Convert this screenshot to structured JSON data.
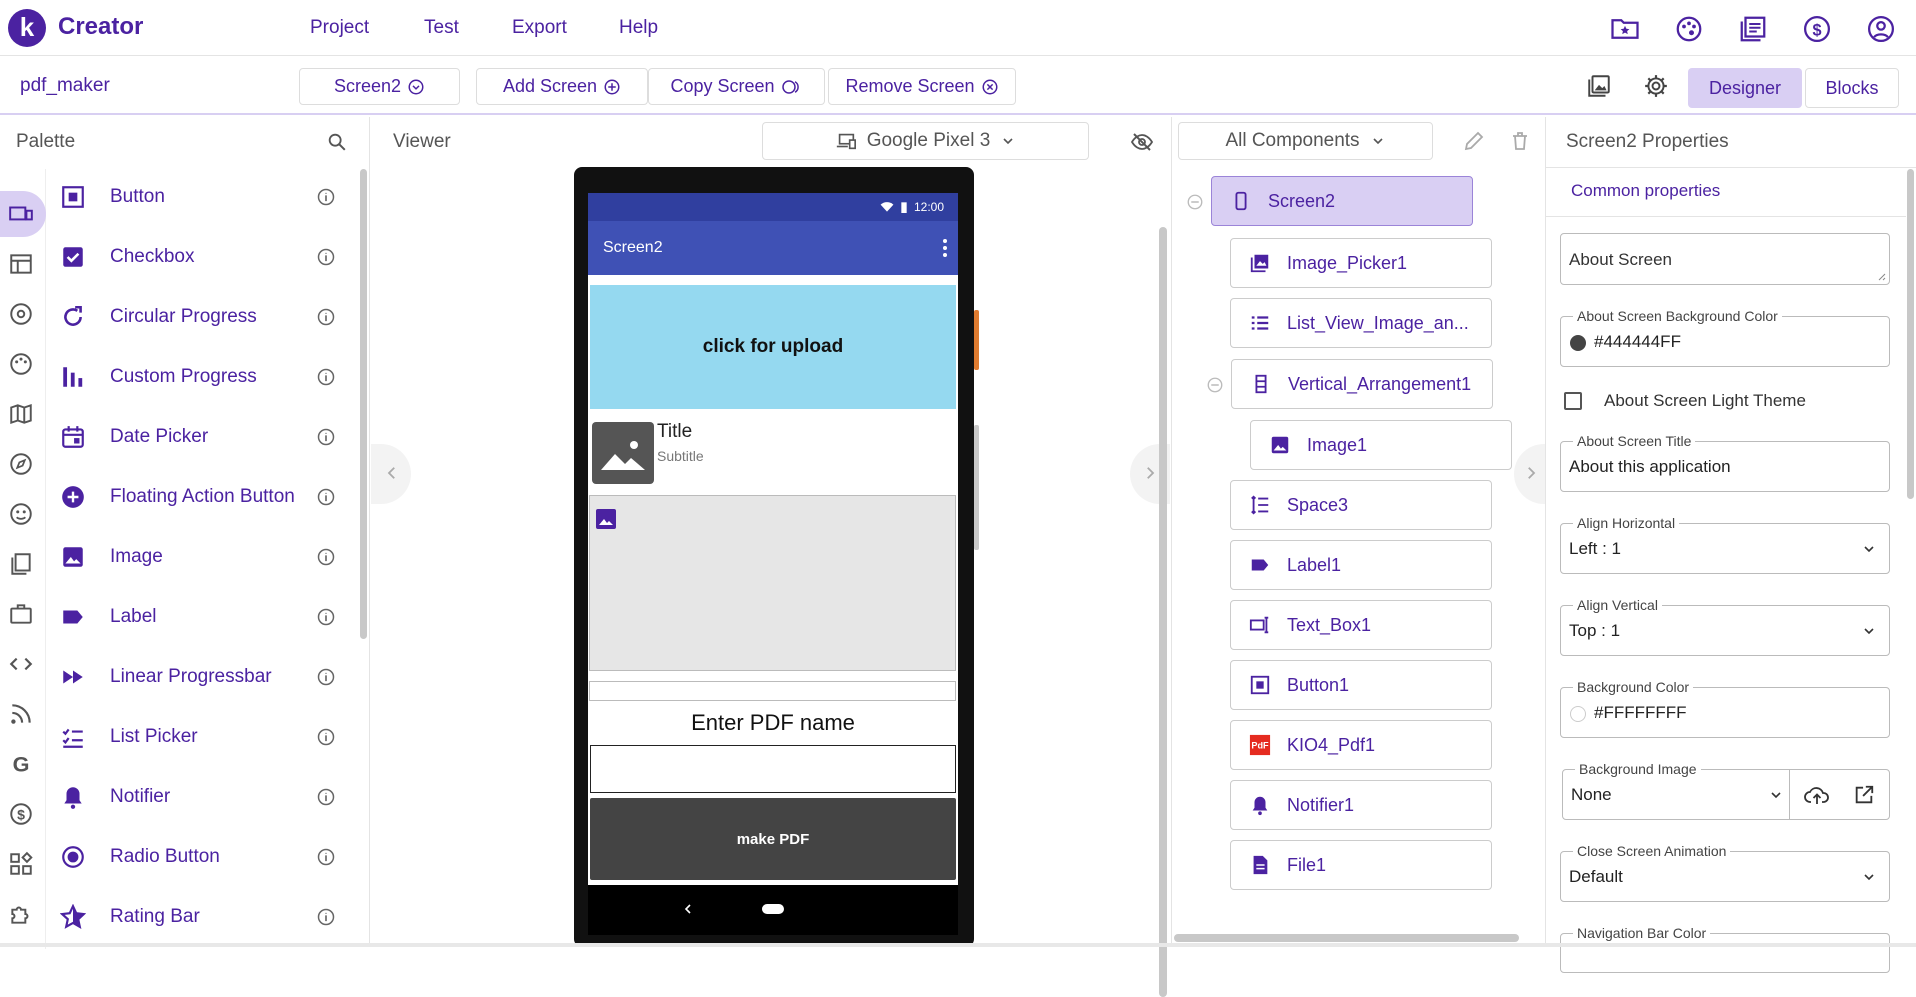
{
  "app": {
    "brand": "Creator",
    "logo_letter": "k"
  },
  "menu": [
    "Project",
    "Test",
    "Export",
    "Help"
  ],
  "top_icons": [
    "folder-star-icon",
    "palette-icon",
    "gallery-icon",
    "dollar-icon",
    "account-icon"
  ],
  "toolbar": {
    "project_name": "pdf_maker",
    "screen_select": "Screen2",
    "add_screen": "Add Screen",
    "copy_screen": "Copy Screen",
    "remove_screen": "Remove Screen",
    "designer": "Designer",
    "blocks": "Blocks"
  },
  "palette": {
    "title": "Palette",
    "items": [
      "Button",
      "Checkbox",
      "Circular Progress",
      "Custom Progress",
      "Date Picker",
      "Floating Action Button",
      "Image",
      "Label",
      "Linear Progressbar",
      "List Picker",
      "Notifier",
      "Radio Button",
      "Rating Bar"
    ]
  },
  "viewer": {
    "title": "Viewer",
    "device": "Google Pixel 3",
    "status_time": "12:00",
    "screen_title": "Screen2",
    "upload_button": "click for upload",
    "list_title": "Title",
    "list_subtitle": "Subtitle",
    "pdf_label": "Enter PDF name",
    "make_pdf": "make PDF"
  },
  "components": {
    "filter": "All Components",
    "items": [
      "Screen2",
      "Image_Picker1",
      "List_View_Image_an...",
      "Vertical_Arrangement1",
      "Image1",
      "Space3",
      "Label1",
      "Text_Box1",
      "Button1",
      "KIO4_Pdf1",
      "Notifier1",
      "File1"
    ]
  },
  "properties": {
    "title": "Screen2 Properties",
    "section": "Common properties",
    "about_screen_placeholder": "About Screen",
    "bg_color_label": "About Screen Background Color",
    "bg_color_value": "#444444FF",
    "light_theme_label": "About Screen Light Theme",
    "about_title_label": "About Screen Title",
    "about_title_value": "About this application",
    "align_h_label": "Align Horizontal",
    "align_h_value": "Left : 1",
    "align_v_label": "Align Vertical",
    "align_v_value": "Top : 1",
    "background_color_label": "Background Color",
    "background_color_value": "#FFFFFFFF",
    "background_image_label": "Background Image",
    "background_image_value": "None",
    "close_anim_label": "Close Screen Animation",
    "close_anim_value": "Default",
    "nav_bar_label": "Navigation Bar Color"
  },
  "colors": {
    "accent": "#4b22a1",
    "active_bg": "#d9cff3",
    "app_bar": "#3f51b5",
    "upload_bg": "#95d9f0",
    "make_pdf_bg": "#444444"
  }
}
